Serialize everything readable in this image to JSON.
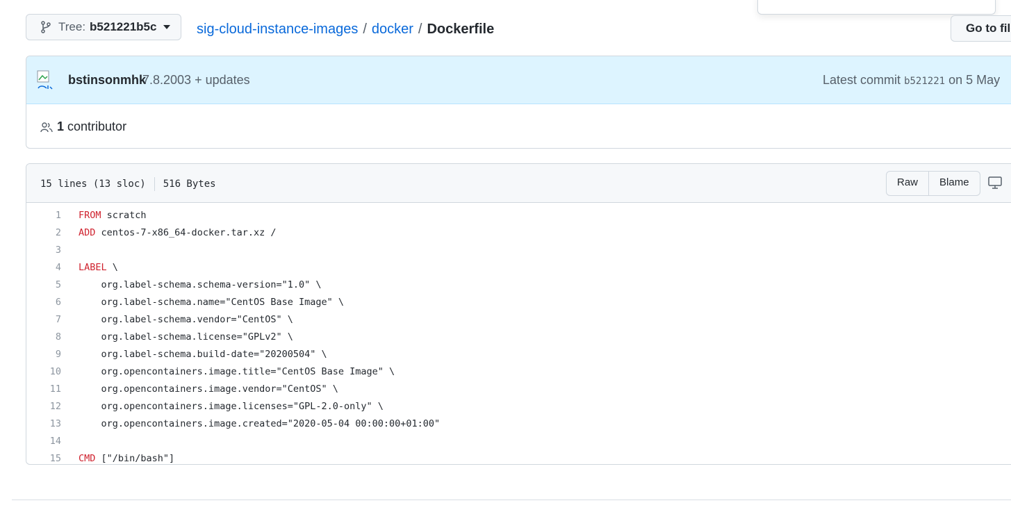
{
  "branch": {
    "label": "Tree:",
    "value": "b521221b5c"
  },
  "breadcrumb": {
    "repo": "sig-cloud-instance-images",
    "dir": "docker",
    "file": "Dockerfile",
    "sep": "/"
  },
  "goto_file": "Go to file",
  "commit": {
    "author": "bstinsonmhk",
    "message": "7.8.2003 + updates",
    "latest_label": "Latest commit",
    "sha": "b521221",
    "date": "on 5 May"
  },
  "contributors": {
    "count": "1",
    "label": "contributor"
  },
  "file_info": {
    "lines": "15 lines (13 sloc)",
    "size": "516 Bytes"
  },
  "buttons": {
    "raw": "Raw",
    "blame": "Blame"
  },
  "code_lines": [
    {
      "n": "1",
      "kw": "FROM",
      "rest": " scratch"
    },
    {
      "n": "2",
      "kw": "ADD",
      "rest": " centos-7-x86_64-docker.tar.xz /"
    },
    {
      "n": "3",
      "kw": "",
      "rest": ""
    },
    {
      "n": "4",
      "kw": "LABEL",
      "rest": " \\"
    },
    {
      "n": "5",
      "kw": "",
      "rest": "    org.label-schema.schema-version=\"1.0\" \\"
    },
    {
      "n": "6",
      "kw": "",
      "rest": "    org.label-schema.name=\"CentOS Base Image\" \\"
    },
    {
      "n": "7",
      "kw": "",
      "rest": "    org.label-schema.vendor=\"CentOS\" \\"
    },
    {
      "n": "8",
      "kw": "",
      "rest": "    org.label-schema.license=\"GPLv2\" \\"
    },
    {
      "n": "9",
      "kw": "",
      "rest": "    org.label-schema.build-date=\"20200504\" \\"
    },
    {
      "n": "10",
      "kw": "",
      "rest": "    org.opencontainers.image.title=\"CentOS Base Image\" \\"
    },
    {
      "n": "11",
      "kw": "",
      "rest": "    org.opencontainers.image.vendor=\"CentOS\" \\"
    },
    {
      "n": "12",
      "kw": "",
      "rest": "    org.opencontainers.image.licenses=\"GPL-2.0-only\" \\"
    },
    {
      "n": "13",
      "kw": "",
      "rest": "    org.opencontainers.image.created=\"2020-05-04 00:00:00+01:00\""
    },
    {
      "n": "14",
      "kw": "",
      "rest": ""
    },
    {
      "n": "15",
      "kw": "CMD",
      "rest": " [\"/bin/bash\"]"
    }
  ],
  "colors": {
    "link": "#0969da",
    "keyword": "#cf222e",
    "commit_bg": "#ddf4ff"
  }
}
